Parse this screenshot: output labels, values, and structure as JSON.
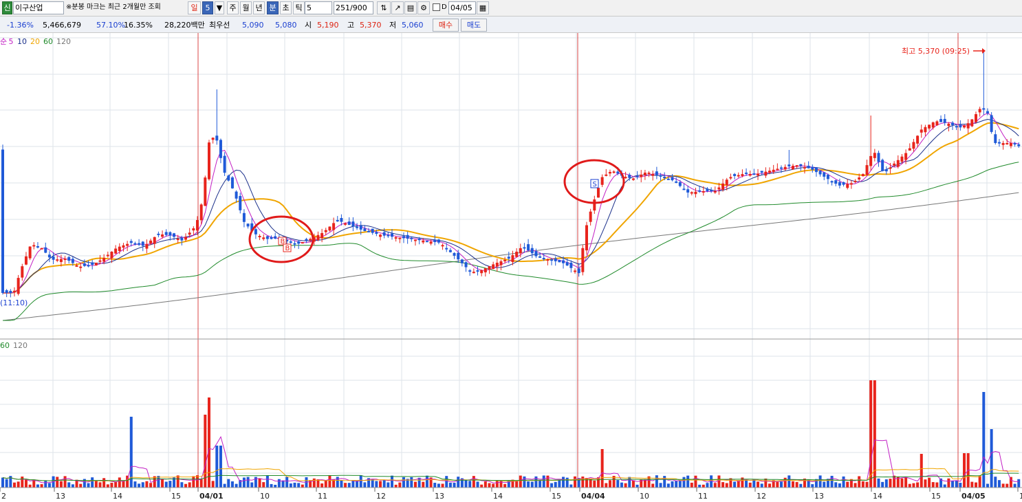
{
  "toolbar": {
    "stock_badge": "신",
    "stock_name": "이구산업",
    "notice": "※분봉 마크는 최근 2개월만 조회",
    "period_tabs": [
      {
        "label": "일",
        "active": false,
        "color": "red"
      },
      {
        "label": "5",
        "active": true,
        "color": ""
      },
      {
        "label": "▼",
        "active": false,
        "color": ""
      },
      {
        "label": "주",
        "active": false,
        "color": ""
      },
      {
        "label": "월",
        "active": false,
        "color": ""
      },
      {
        "label": "년",
        "active": false,
        "color": ""
      },
      {
        "label": "분",
        "active": true,
        "color": ""
      },
      {
        "label": "초",
        "active": false,
        "color": ""
      },
      {
        "label": "틱",
        "active": false,
        "color": ""
      }
    ],
    "interval_value": "5",
    "count_current": "251",
    "count_max": "/900",
    "date_value": "04/05",
    "icons": [
      "toggle-icon",
      "zoom-icon",
      "save-icon",
      "settings-icon"
    ]
  },
  "quote": {
    "change_pct": "-1.36%",
    "volume": "5,466,679",
    "ratio1": "57.10%",
    "ratio2": "16.35%",
    "amount": "28,220백만",
    "best_bid_label": "최우선",
    "best_ask": "5,090",
    "best_bid": "5,080",
    "open_label": "시",
    "open": "5,190",
    "high_label": "고",
    "high": "5,370",
    "low_label": "저",
    "low": "5,060",
    "buy_label": "매수",
    "sell_label": "매도"
  },
  "colors": {
    "up": "#e8241c",
    "down": "#1f5ad8",
    "ma5": "#c21fc4",
    "ma10": "#1a2f8a",
    "ma20": "#f0a500",
    "ma60": "#1f8a2a",
    "ma120": "#777777",
    "grid": "#dde3ea",
    "day_line": "#d84545"
  },
  "chart_data": {
    "type": "candlestick",
    "price_legend": [
      {
        "label": "순",
        "color": "#c21fc4"
      },
      {
        "label": "5",
        "color": "#c21fc4"
      },
      {
        "label": "10",
        "color": "#1a2f8a"
      },
      {
        "label": "20",
        "color": "#f0a500"
      },
      {
        "label": "60",
        "color": "#1f8a2a"
      },
      {
        "label": "120",
        "color": "#777777"
      }
    ],
    "volume_legend": [
      {
        "label": "60",
        "color": "#1f8a2a"
      },
      {
        "label": "120",
        "color": "#777777"
      }
    ],
    "x_ticks": [
      "2",
      "13",
      "14",
      "15",
      "04/01",
      "10",
      "11",
      "12",
      "13",
      "14",
      "15",
      "04/04",
      "10",
      "11",
      "12",
      "13",
      "14",
      "15",
      "04/05",
      "1"
    ],
    "day_boundaries": [
      "04/01",
      "04/04",
      "04/05"
    ],
    "annotations": {
      "high_label": "최고 5,370 (09:25)",
      "low_label": "(11:10)",
      "buy_marks": [
        "B",
        "B"
      ],
      "sell_mark": "S"
    }
  }
}
